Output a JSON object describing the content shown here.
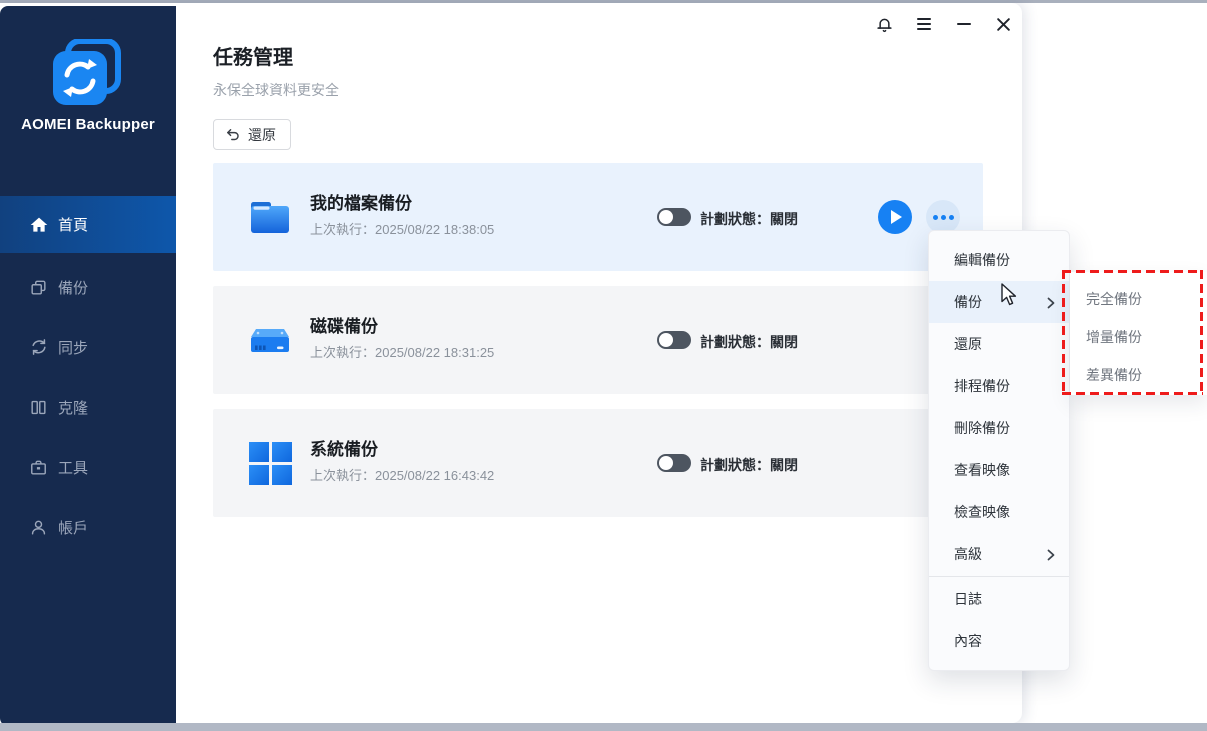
{
  "app": {
    "name": "AOMEI Backupper"
  },
  "titlebar": {
    "icons": [
      "bell-icon",
      "menu-icon",
      "minimize-icon",
      "close-icon"
    ]
  },
  "sidebar": {
    "items": [
      {
        "label": "首頁",
        "icon": "home",
        "active": true
      },
      {
        "label": "備份",
        "icon": "backup",
        "active": false
      },
      {
        "label": "同步",
        "icon": "sync",
        "active": false
      },
      {
        "label": "克隆",
        "icon": "clone",
        "active": false
      },
      {
        "label": "工具",
        "icon": "tools",
        "active": false
      },
      {
        "label": "帳戶",
        "icon": "account",
        "active": false
      }
    ]
  },
  "header": {
    "title": "任務管理",
    "subtitle": "永保全球資料更安全",
    "restore_label": "還原"
  },
  "tasks": [
    {
      "name": "我的檔案備份",
      "last_run": "上次執行：2025/08/22 18:38:05",
      "schedule_status": "計劃狀態：關閉",
      "icon": "folder",
      "toggle": "off",
      "highlighted": true
    },
    {
      "name": "磁碟備份",
      "last_run": "上次執行：2025/08/22 18:31:25",
      "schedule_status": "計劃狀態：關閉",
      "icon": "disk",
      "toggle": "off",
      "highlighted": false
    },
    {
      "name": "系統備份",
      "last_run": "上次執行：2025/08/22 16:43:42",
      "schedule_status": "計劃狀態：關閉",
      "icon": "windows",
      "toggle": "off",
      "highlighted": false
    }
  ],
  "context_menu": {
    "items": [
      {
        "label": "編輯備份",
        "has_submenu": false,
        "highlighted": false
      },
      {
        "label": "備份",
        "has_submenu": true,
        "highlighted": true
      },
      {
        "label": "還原",
        "has_submenu": false,
        "highlighted": false
      },
      {
        "label": "排程備份",
        "has_submenu": false,
        "highlighted": false
      },
      {
        "label": "刪除備份",
        "has_submenu": false,
        "highlighted": false
      },
      {
        "label": "查看映像",
        "has_submenu": false,
        "highlighted": false
      },
      {
        "label": "檢查映像",
        "has_submenu": false,
        "highlighted": false
      },
      {
        "label": "高級",
        "has_submenu": true,
        "highlighted": false
      },
      {
        "label": "日誌",
        "has_submenu": false,
        "highlighted": false,
        "divider_before": true
      },
      {
        "label": "內容",
        "has_submenu": false,
        "highlighted": false
      }
    ]
  },
  "submenu": {
    "items": [
      "完全備份",
      "增量備份",
      "差異備份"
    ]
  },
  "colors": {
    "accent_blue": "#1781f3",
    "sidebar_navy": "#162a4e",
    "active_item_gradient": [
      "#11417f",
      "#0e57ab"
    ],
    "row_highlight": "#e9f2fd",
    "row_default": "#f4f5f7",
    "menu_highlight": "#e9f1fb",
    "red_dashed_border": "#ee1b1b"
  }
}
